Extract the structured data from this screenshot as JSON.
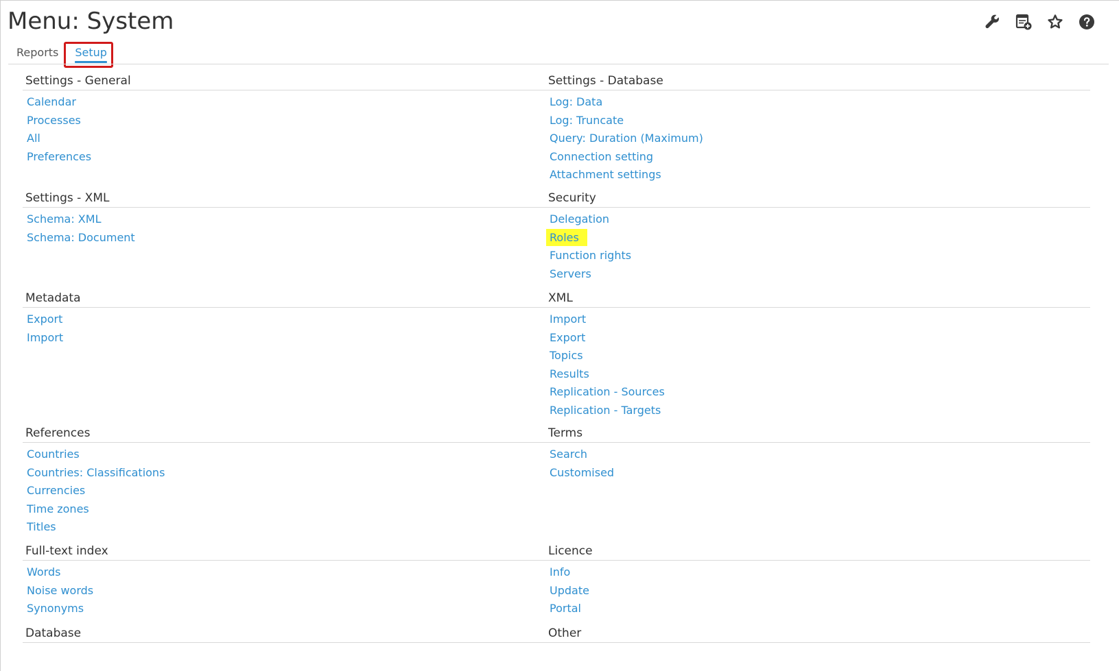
{
  "header": {
    "title": "Menu: System",
    "icons": [
      "wrench-icon",
      "add-page-icon",
      "star-icon",
      "help-icon"
    ]
  },
  "tabs": [
    {
      "label": "Reports",
      "active": false
    },
    {
      "label": "Setup",
      "active": true
    }
  ],
  "colors": {
    "link": "#2f8fd0",
    "highlight": "#ffff33",
    "tab_outline": "#d11a1a"
  },
  "sections": {
    "settings_general": {
      "title": "Settings - General",
      "items": [
        "Calendar",
        "Processes",
        "All",
        "Preferences"
      ]
    },
    "settings_database": {
      "title": "Settings - Database",
      "items": [
        "Log: Data",
        "Log: Truncate",
        "Query: Duration (Maximum)",
        "Connection setting",
        "Attachment settings"
      ]
    },
    "settings_xml": {
      "title": "Settings - XML",
      "items": [
        "Schema: XML",
        "Schema: Document"
      ]
    },
    "security": {
      "title": "Security",
      "items": [
        "Delegation",
        "Roles",
        "Function rights",
        "Servers"
      ]
    },
    "metadata": {
      "title": "Metadata",
      "items": [
        "Export",
        "Import"
      ]
    },
    "xml": {
      "title": "XML",
      "items": [
        "Import",
        "Export",
        "Topics",
        "Results",
        "Replication - Sources",
        "Replication - Targets"
      ]
    },
    "references": {
      "title": "References",
      "items": [
        "Countries",
        "Countries: Classifications",
        "Currencies",
        "Time zones",
        "Titles"
      ]
    },
    "terms": {
      "title": "Terms",
      "items": [
        "Search",
        "Customised"
      ]
    },
    "fulltext": {
      "title": "Full-text index",
      "items": [
        "Words",
        "Noise words",
        "Synonyms"
      ]
    },
    "licence": {
      "title": "Licence",
      "items": [
        "Info",
        "Update",
        "Portal"
      ]
    },
    "database": {
      "title": "Database",
      "items": []
    },
    "other": {
      "title": "Other",
      "items": []
    }
  }
}
